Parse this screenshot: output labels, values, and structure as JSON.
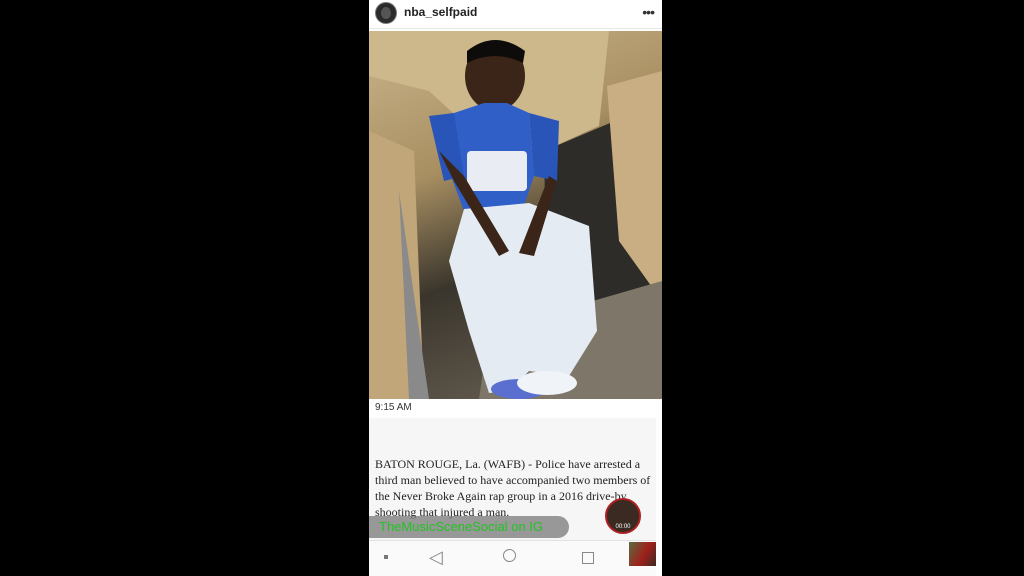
{
  "post": {
    "username": "nba_selfpaid",
    "more_icon": "more-dots-icon",
    "time": "9:15 AM"
  },
  "article": {
    "text": "BATON ROUGE, La. (WAFB) - Police have arrested a third man believed to have accompanied two members of the Never Broke Again rap group in a 2016 drive-by shooting that injured a man."
  },
  "overlay": {
    "badge": "TheMusicSceneSocial on IG",
    "recording_time": "00:00"
  },
  "navbar": {
    "icons": [
      "square-dot-icon",
      "back-triangle-icon",
      "home-circle-icon",
      "recents-square-icon"
    ]
  },
  "colors": {
    "badge_text": "#22c322",
    "background": "#000000"
  }
}
